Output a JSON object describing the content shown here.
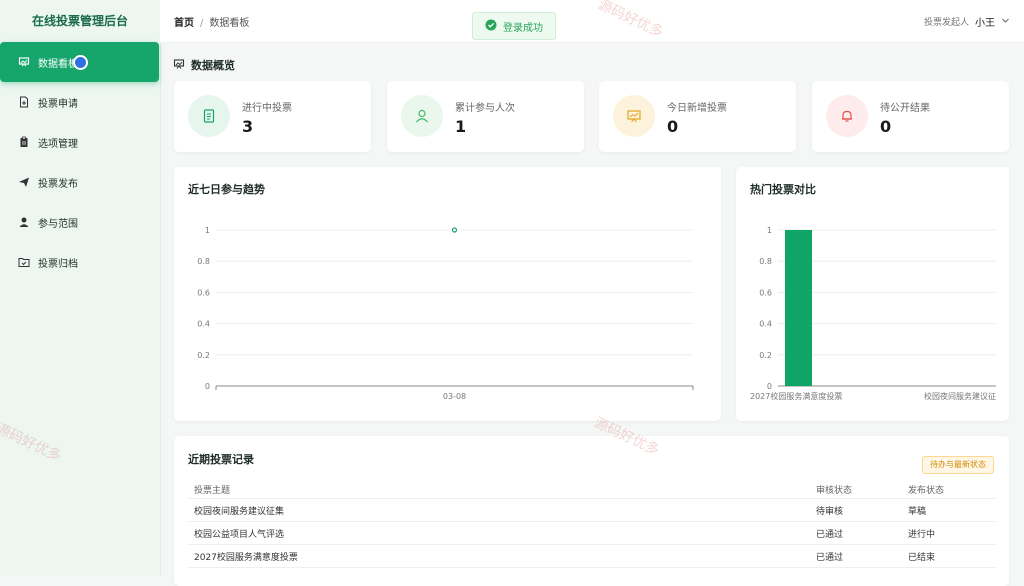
{
  "brand": "在线投票管理后台",
  "sidebar": {
    "items": [
      {
        "label": "数据看板",
        "active": true
      },
      {
        "label": "投票申请"
      },
      {
        "label": "选项管理"
      },
      {
        "label": "投票发布"
      },
      {
        "label": "参与范围"
      },
      {
        "label": "投票归档"
      }
    ]
  },
  "header": {
    "breadcrumb_home": "首页",
    "breadcrumb_sep": "/",
    "breadcrumb_current": "数据看板",
    "toast": "登录成功",
    "user_role": "投票发起人",
    "user_name": "小王"
  },
  "overview": {
    "title": "数据概览",
    "stats": [
      {
        "label": "进行中投票",
        "value": "3",
        "icon": "document-icon",
        "color": "#16a56b",
        "bg": "#e6f6ee"
      },
      {
        "label": "累计参与人次",
        "value": "1",
        "icon": "user-icon",
        "color": "#3fb96b",
        "bg": "#e9f7ec"
      },
      {
        "label": "今日新增投票",
        "value": "0",
        "icon": "presentation-icon",
        "color": "#e5a020",
        "bg": "#fdf3dd"
      },
      {
        "label": "待公开结果",
        "value": "0",
        "icon": "bell-icon",
        "color": "#e0504a",
        "bg": "#fdeceb"
      }
    ]
  },
  "trend": {
    "title": "近七日参与趋势"
  },
  "compare": {
    "title": "热门投票对比"
  },
  "chart_data": [
    {
      "type": "line",
      "title": "近七日参与趋势",
      "x": [
        "03-08"
      ],
      "series": [
        {
          "values": [
            1
          ]
        }
      ],
      "ylim": [
        0,
        1
      ],
      "yticks": [
        "0",
        "0.2",
        "0.4",
        "0.6",
        "0.8",
        "1"
      ],
      "grid": true
    },
    {
      "type": "bar",
      "title": "热门投票对比",
      "categories": [
        "2027校园服务满意度投票",
        "校园夜间服务建议征"
      ],
      "values": [
        1,
        0
      ],
      "ylim": [
        0,
        1
      ],
      "yticks": [
        "0",
        "0.2",
        "0.4",
        "0.6",
        "0.8",
        "1"
      ],
      "color": "#0fa566",
      "grid": true
    }
  ],
  "records": {
    "title": "近期投票记录",
    "tag": "待办与最新状态",
    "columns": [
      "投票主题",
      "审核状态",
      "发布状态"
    ],
    "rows": [
      [
        "校园夜间服务建议征集",
        "待审核",
        "草稿"
      ],
      [
        "校园公益项目人气评选",
        "已通过",
        "进行中"
      ],
      [
        "2027校园服务满意度投票",
        "已通过",
        "已结束"
      ]
    ]
  },
  "watermark": "源码好优多"
}
